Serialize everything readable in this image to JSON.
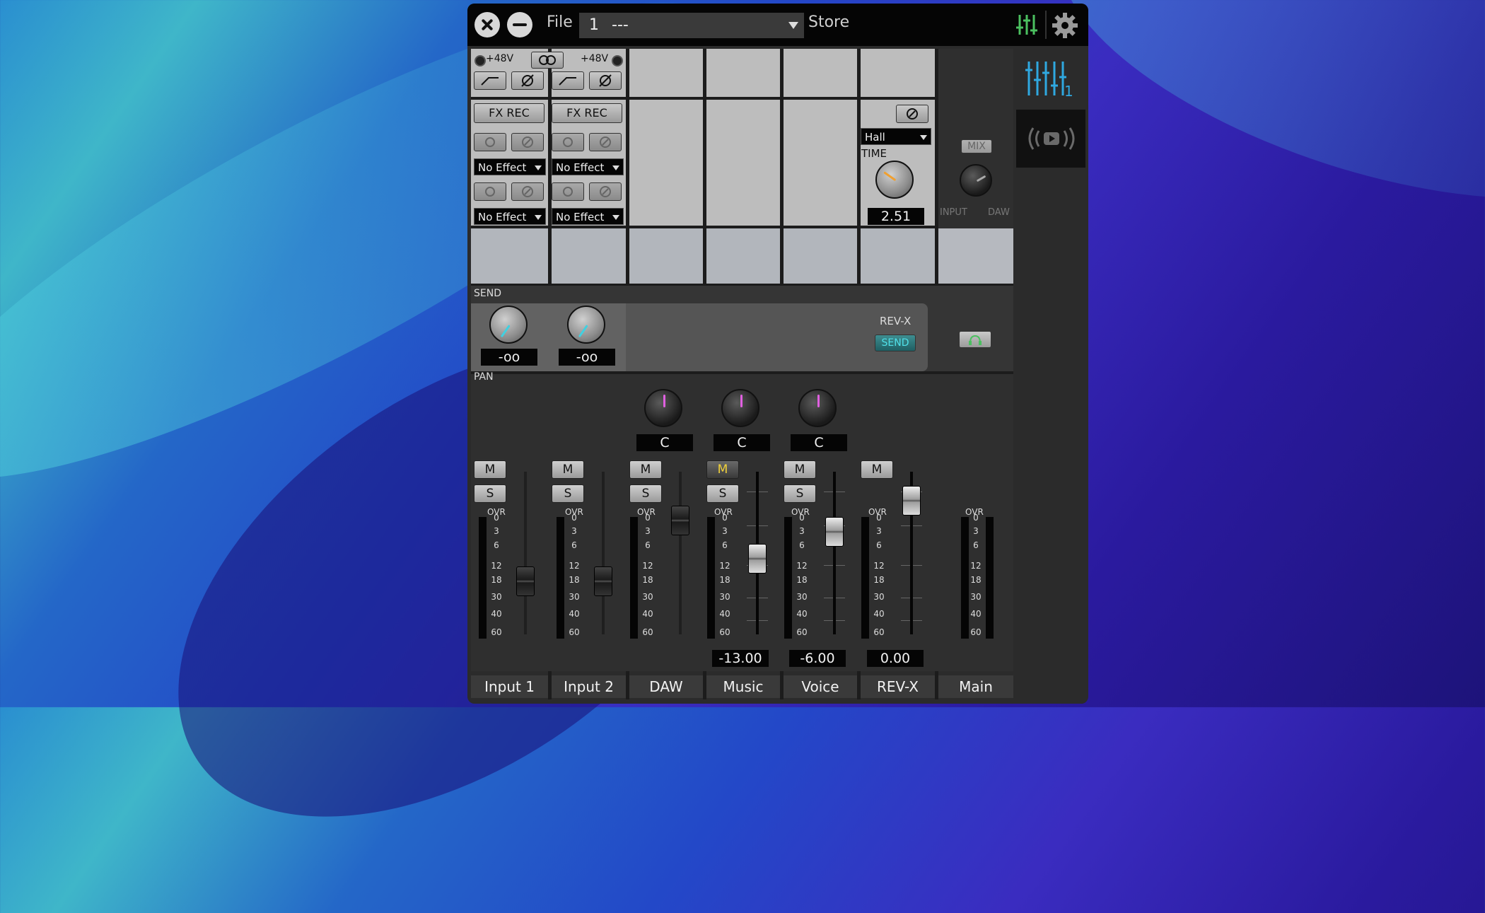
{
  "window": {
    "file_label": "File",
    "scene_number": "1",
    "scene_name": "---",
    "store_label": "Store"
  },
  "strip": {
    "phantom_label": "+48V",
    "send_label": "SEND",
    "pan_label": "PAN",
    "fx_rec_label": "FX REC",
    "no_effect": "No Effect",
    "mute": "M",
    "solo": "S",
    "ovr": "OVR",
    "scale": [
      "0",
      "3",
      "6",
      "12",
      "18",
      "30",
      "40",
      "60"
    ],
    "send_values": [
      "-oo",
      "-oo"
    ],
    "pan_values": [
      "C",
      "C",
      "C"
    ]
  },
  "reverb": {
    "type": "Hall",
    "time_label": "TIME",
    "time_value": "2.51",
    "name": "REV-X",
    "send_button": "SEND"
  },
  "monitor": {
    "mix_label": "MIX",
    "input_label": "INPUT",
    "daw_label": "DAW"
  },
  "faders": {
    "music_value": "-13.00",
    "voice_value": "-6.00",
    "revx_value": "0.00"
  },
  "channels": [
    "Input 1",
    "Input 2",
    "DAW",
    "Music",
    "Voice",
    "REV-X",
    "Main"
  ],
  "tabs": {
    "mixer_number": "1"
  },
  "colors": {
    "accent": "#2fa8e0",
    "mute_on": "#f0d03a",
    "pan_indicator": "#e060e0",
    "send_indicator": "#40d0e0",
    "app_icon": "#4bc060",
    "reverb_knob": "#f0a030"
  }
}
